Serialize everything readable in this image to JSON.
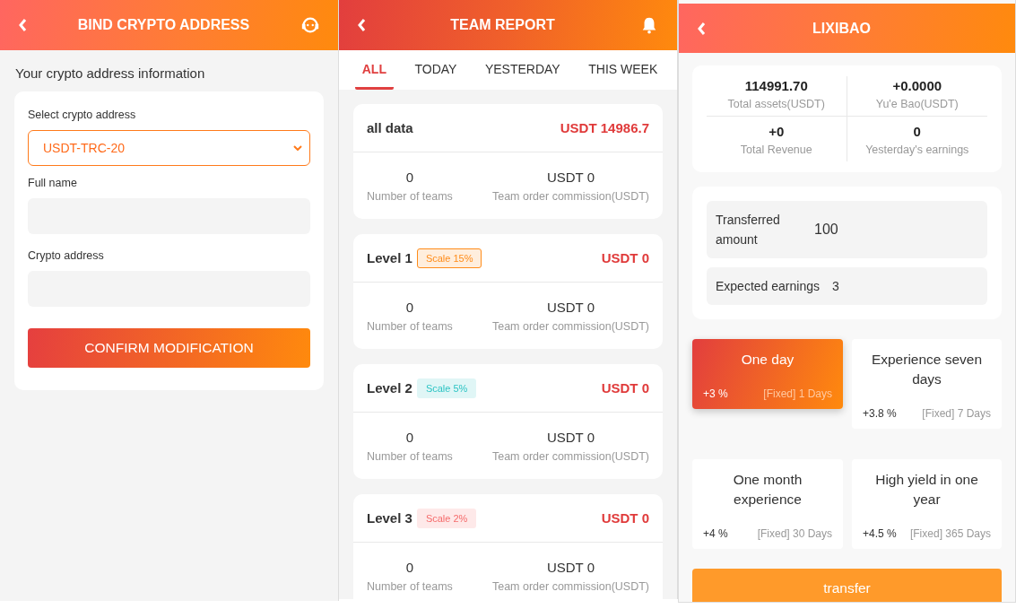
{
  "bind_panel": {
    "title": "BIND CRYPTO ADDRESS",
    "section_title": "Your crypto address information",
    "fields": [
      {
        "kind": "select",
        "label": "Select crypto address",
        "value": "USDT-TRC-20"
      },
      {
        "kind": "text",
        "label": "Full name"
      },
      {
        "kind": "text",
        "label": "Crypto address"
      }
    ],
    "confirm_button": "CONFIRM MODIFICATION"
  },
  "team_panel": {
    "title": "TEAM REPORT",
    "tabs": [
      {
        "label": "ALL",
        "selected": true
      },
      {
        "label": "TODAY",
        "selected": false
      },
      {
        "label": "YESTERDAY",
        "selected": false
      },
      {
        "label": "THIS WEEK",
        "selected": false
      }
    ],
    "cards": [
      {
        "title": "all data",
        "total": "USDT 14986.7",
        "teams": "0",
        "teams_label": "Number of teams",
        "commission": "USDT 0",
        "commission_label": "Team order commission(USDT)"
      },
      {
        "title": "Level 1",
        "badge": {
          "text": "Scale 15%",
          "color": "#ff8c1a"
        },
        "total": "USDT 0",
        "teams": "0",
        "teams_label": "Number of teams",
        "commission": "USDT 0",
        "commission_label": "Team order commission(USDT)"
      },
      {
        "title": "Level 2",
        "badge": {
          "text": "Scale 5%",
          "color": "#2ec4c4"
        },
        "total": "USDT 0",
        "teams": "0",
        "teams_label": "Number of teams",
        "commission": "USDT 0",
        "commission_label": "Team order commission(USDT)"
      },
      {
        "title": "Level 3",
        "badge": {
          "text": "Scale 2%",
          "color": "#f56c6c"
        },
        "total": "USDT 0",
        "teams": "0",
        "teams_label": "Number of teams",
        "commission": "USDT 0",
        "commission_label": "Team order commission(USDT)"
      }
    ]
  },
  "lixibao_panel": {
    "title": "LIXIBAO",
    "stats": [
      {
        "value": "114991.70",
        "label": "Total assets(USDT)"
      },
      {
        "value": "+0.0000",
        "label": "Yu'e Bao(USDT)"
      },
      {
        "value": "+0",
        "label": "Total Revenue"
      },
      {
        "value": "0",
        "label": "Yesterday's earnings"
      }
    ],
    "transferred_amount": {
      "label": "Transferred amount",
      "value": "100"
    },
    "expected_earnings": {
      "label": "Expected earnings",
      "value": "3"
    },
    "plans": [
      {
        "name": "One day",
        "rate": "+3 %",
        "term": "[Fixed] 1 Days",
        "selected": true
      },
      {
        "name": "Experience seven days",
        "rate": "+3.8 %",
        "term": "[Fixed] 7 Days",
        "selected": false
      },
      {
        "name": "One month experience",
        "rate": "+4 %",
        "term": "[Fixed] 30 Days",
        "selected": false
      },
      {
        "name": "High yield in one year",
        "rate": "+4.5 %",
        "term": "[Fixed] 365 Days",
        "selected": false
      }
    ],
    "transfer_button": "transfer"
  }
}
